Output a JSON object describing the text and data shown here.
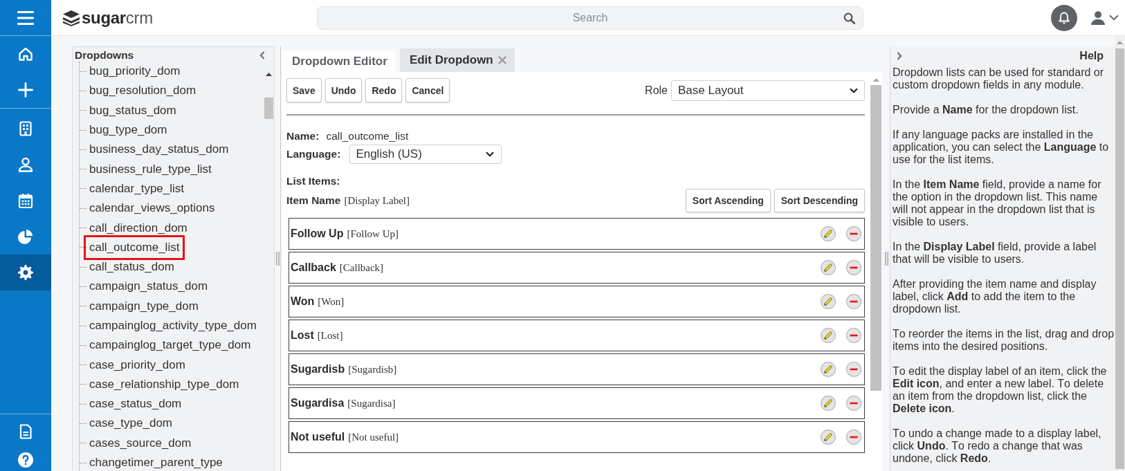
{
  "nav": {
    "groups": [
      {
        "items": [
          {
            "selected": false
          },
          {
            "selected": false
          }
        ]
      },
      {
        "items": [
          {
            "selected": false
          },
          {
            "selected": false
          },
          {
            "selected": false
          },
          {
            "selected": false
          },
          {
            "selected": true
          }
        ]
      },
      {
        "items": [
          {
            "selected": false
          },
          {
            "selected": false
          }
        ]
      }
    ]
  },
  "header": {
    "logo": "**sugar**crm",
    "search": {
      "placeholder": "Search"
    }
  },
  "dropdowns_panel": {
    "title": "Dropdowns",
    "items": [
      {
        "label": "bug_priority_dom",
        "selected": false
      },
      {
        "label": "bug_resolution_dom",
        "selected": false
      },
      {
        "label": "bug_status_dom",
        "selected": false
      },
      {
        "label": "bug_type_dom",
        "selected": false
      },
      {
        "label": "business_day_status_dom",
        "selected": false
      },
      {
        "label": "business_rule_type_list",
        "selected": false
      },
      {
        "label": "calendar_type_list",
        "selected": false
      },
      {
        "label": "calendar_views_options",
        "selected": false
      },
      {
        "label": "call_direction_dom",
        "selected": false
      },
      {
        "label": "call_outcome_list",
        "selected": true
      },
      {
        "label": "call_status_dom",
        "selected": false
      },
      {
        "label": "campaign_status_dom",
        "selected": false
      },
      {
        "label": "campaign_type_dom",
        "selected": false
      },
      {
        "label": "campainglog_activity_type_dom",
        "selected": false
      },
      {
        "label": "campainglog_target_type_dom",
        "selected": false
      },
      {
        "label": "case_priority_dom",
        "selected": false
      },
      {
        "label": "case_relationship_type_dom",
        "selected": false
      },
      {
        "label": "case_status_dom",
        "selected": false
      },
      {
        "label": "case_type_dom",
        "selected": false
      },
      {
        "label": "cases_source_dom",
        "selected": false
      },
      {
        "label": "changetimer_parent_type",
        "selected": false
      }
    ]
  },
  "editor": {
    "tabs": [
      {
        "label": "Dropdown Editor",
        "selected": true,
        "closable": false
      },
      {
        "label": "Edit Dropdown",
        "selected": false,
        "closable": true
      }
    ],
    "buttons": [
      "Save",
      "Undo",
      "Redo",
      "Cancel"
    ],
    "role": {
      "label": "Role",
      "value": "Base Layout"
    },
    "name": {
      "label": "Name:",
      "value": "call_outcome_list"
    },
    "language": {
      "label": "Language:",
      "value": "English (US)"
    },
    "list_items_label": "List Items:",
    "columns": {
      "item_name": "Item Name",
      "display_label": "[Display Label]"
    },
    "sort_buttons": [
      "Sort Ascending",
      "Sort Descending"
    ],
    "items": [
      {
        "name": "Follow Up",
        "display_label": "[Follow Up]"
      },
      {
        "name": "Callback",
        "display_label": "[Callback]"
      },
      {
        "name": "Won",
        "display_label": "[Won]"
      },
      {
        "name": "Lost",
        "display_label": "[Lost]"
      },
      {
        "name": "Sugardisb",
        "display_label": "[Sugardisb]"
      },
      {
        "name": "Sugardisa",
        "display_label": "[Sugardisa]"
      },
      {
        "name": "Not useful",
        "display_label": "[Not useful]"
      }
    ]
  },
  "help": {
    "title": "Help",
    "paragraphs": [
      "Dropdown lists can be used for standard or custom dropdown fields in any module.",
      "Provide a **Name** for the dropdown list.",
      "If any language packs are installed in the application, you can select the **Language** to use for the list items.",
      "In the **Item Name** field, provide a name for the option in the dropdown list. This name will not appear in the dropdown list that is visible to users.",
      "In the **Display Label** field, provide a label that will be visible to users.",
      "After providing the item name and display label, click **Add** to add the item to the dropdown list.",
      "To reorder the items in the list, drag and drop items into the desired positions.",
      "To edit the display label of an item, click the **Edit icon**, and enter a new label. To delete an item from the dropdown list, click the **Delete icon**.",
      "To undo a change made to a display label, click **Undo**. To redo a change that was undone, click **Redo**."
    ]
  }
}
